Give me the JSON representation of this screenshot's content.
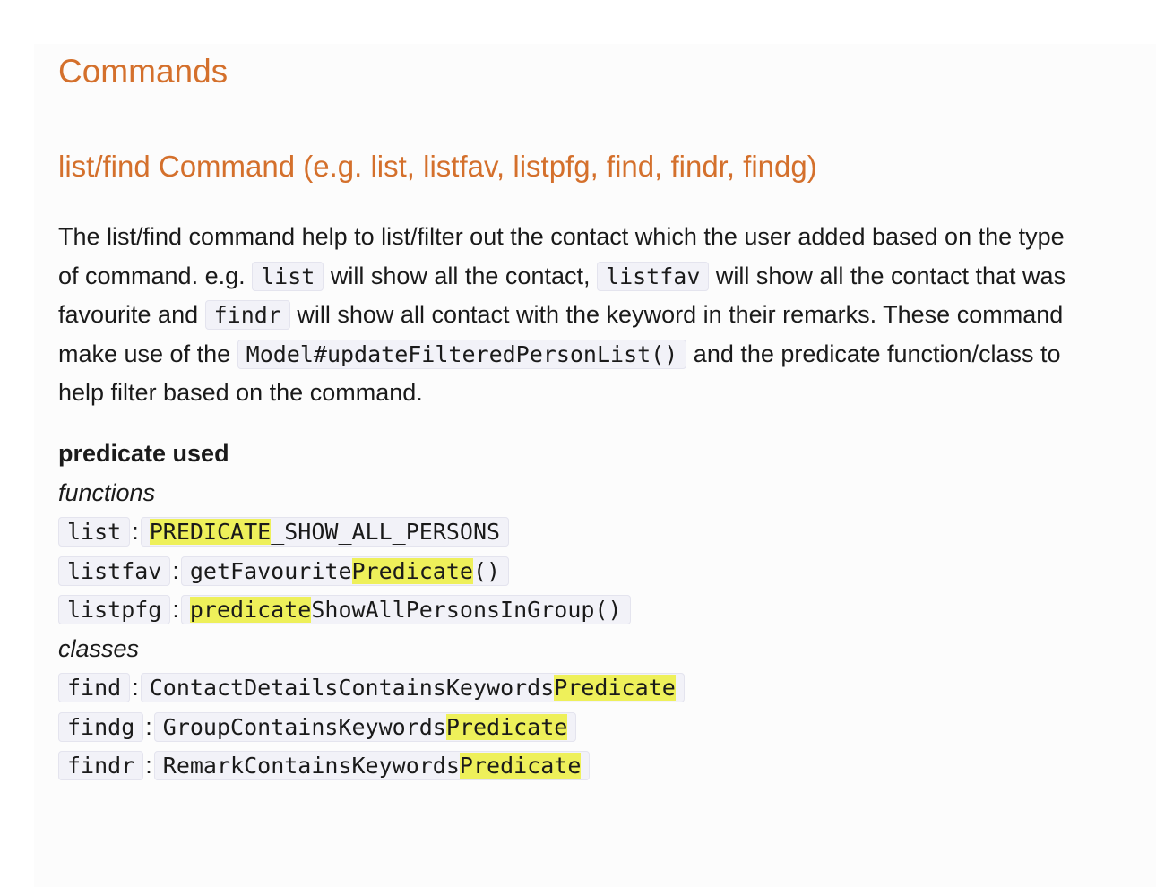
{
  "heading": "Commands",
  "subheading": "list/find Command (e.g. list, listfav, listpfg, find, findr, findg)",
  "paragraph": {
    "l1": "The list/find command help to list/filter out the contact which the user added based on the type",
    "l2a": "of command. e.g.",
    "l2code1": "list",
    "l2b": "will show all the contact,",
    "l2code2": "listfav",
    "l2c": "will show all the contact that was",
    "l3a": "favourite and",
    "l3code": "findr",
    "l3b": "will show all contact with the keyword in their remarks. These command",
    "l4a": "make use of the",
    "l4code": "Model#updateFilteredPersonList()",
    "l4b": "and the predicate function/class to",
    "l5": "help filter based on the command."
  },
  "predicates": {
    "title": "predicate used",
    "functions_label": "functions",
    "classes_label": "classes",
    "separator": ":",
    "functions": [
      {
        "cmd": "list",
        "pre": "",
        "hl": "PREDICATE",
        "post": "_SHOW_ALL_PERSONS"
      },
      {
        "cmd": "listfav",
        "pre": "getFavourite",
        "hl": "Predicate",
        "post": "()"
      },
      {
        "cmd": "listpfg",
        "pre": "",
        "hl": "predicate",
        "post": "ShowAllPersonsInGroup()"
      }
    ],
    "classes": [
      {
        "cmd": "find",
        "pre": "ContactDetailsContainsKeywords",
        "hl": "Predicate",
        "post": ""
      },
      {
        "cmd": "findg",
        "pre": "GroupContainsKeywords",
        "hl": "Predicate",
        "post": ""
      },
      {
        "cmd": "findr",
        "pre": "RemarkContainsKeywords",
        "hl": "Predicate",
        "post": ""
      }
    ]
  }
}
